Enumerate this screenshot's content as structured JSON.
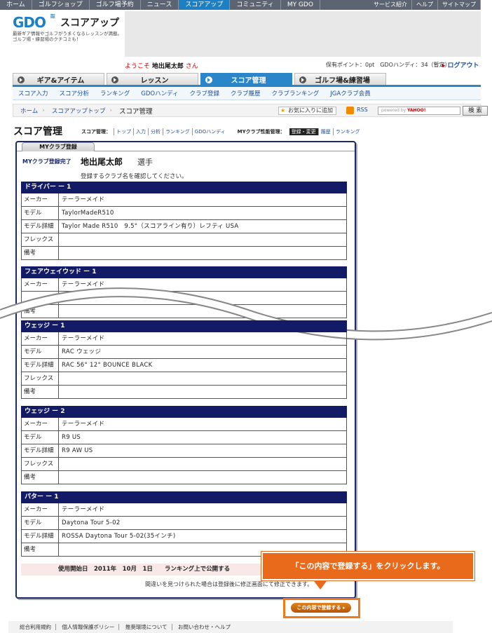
{
  "topnav": {
    "items": [
      "ホーム",
      "ゴルフショップ",
      "ゴルフ場予約",
      "ニュース",
      "スコアアップ",
      "コミュニティ",
      "MY GDO"
    ],
    "right": [
      "サービス紹介",
      "ヘルプ",
      "サイトマップ"
    ]
  },
  "header": {
    "logo": "GDO",
    "site_title": "スコアアップ",
    "tagline": "最新ギア情報やゴルフがうまくなるレッスンが満載。ゴルフ場・練習場のクチコミも！",
    "welcome_prefix": "ようこそ",
    "user_name": "地出尾太郎",
    "welcome_suffix": "さん",
    "points": "保有ポイント：0pt　GDOハンディ：34（暫定）",
    "logout": "ログアウト"
  },
  "bigtabs": [
    "ギア&アイテム",
    "レッスン",
    "スコア管理",
    "ゴルフ場&練習場"
  ],
  "subnav": [
    "スコア入力",
    "スコア分析",
    "ランキング",
    "GDOハンディ",
    "クラブ登録",
    "クラブ履歴",
    "クラブランキング",
    "JGAクラブ会員"
  ],
  "breadcrumb": [
    "ホーム",
    "スコアアップトップ",
    "スコア管理"
  ],
  "toolbar": {
    "favorite": "お気に入りに追加",
    "rss": "RSS",
    "search_placeholder": "powered by",
    "search_brand": "YAHOO!",
    "search_button": "検 索"
  },
  "page": {
    "title": "スコア管理",
    "menu1_label": "スコア管理：",
    "menu1": [
      "トップ",
      "入力",
      "分析",
      "ランキング",
      "GDOハンディ"
    ],
    "menu2_label": "MYクラブ性能管理：",
    "menu2": [
      "登録・変更",
      "履歴",
      "ランキング"
    ]
  },
  "card": {
    "tab": "MYクラブ登録",
    "done_label": "MYクラブ登録完了",
    "player_name": "地出尾太郎",
    "player_suffix": "選手",
    "confirm": "登録するクラブ名を確認してください。",
    "sections": [
      {
        "head": "ドライバー ー 1",
        "rows": [
          {
            "k": "メーカー",
            "v": "テーラーメイド"
          },
          {
            "k": "モデル",
            "v": "TaylorMadeR510"
          },
          {
            "k": "モデル詳細",
            "v": "Taylor Made R510　9.5°（スコアライン有り）レフティ USA"
          },
          {
            "k": "フレックス",
            "v": ""
          },
          {
            "k": "備考",
            "v": ""
          }
        ]
      },
      {
        "head": "フェアウェイウッド ー 1",
        "rows": [
          {
            "k": "メーカー",
            "v": "テーラーメイド"
          },
          {
            "k": "",
            "v": ""
          },
          {
            "k": "備考",
            "v": ""
          }
        ]
      },
      {
        "head": "ウェッジ ー 1",
        "rows": [
          {
            "k": "メーカー",
            "v": "テーラーメイド"
          },
          {
            "k": "モデル",
            "v": "RAC ウェッジ"
          },
          {
            "k": "モデル詳細",
            "v": "RAC 56° 12° BOUNCE BLACK"
          },
          {
            "k": "フレックス",
            "v": ""
          },
          {
            "k": "備考",
            "v": ""
          }
        ]
      },
      {
        "head": "ウェッジ ー 2",
        "rows": [
          {
            "k": "メーカー",
            "v": "テーラーメイド"
          },
          {
            "k": "モデル",
            "v": "R9 US"
          },
          {
            "k": "モデル詳細",
            "v": "R9 AW US"
          },
          {
            "k": "フレックス",
            "v": ""
          },
          {
            "k": "備考",
            "v": ""
          }
        ]
      },
      {
        "head": "パター ー 1",
        "rows": [
          {
            "k": "メーカー",
            "v": "テーラーメイド"
          },
          {
            "k": "モデル",
            "v": "Daytona Tour 5-02"
          },
          {
            "k": "モデル詳細",
            "v": "ROSSA Daytona Tour 5-02(35インチ)"
          },
          {
            "k": "備考",
            "v": ""
          }
        ]
      }
    ],
    "start": "使用開始日　2011年　10月　1日　　ランキング上で公開する",
    "note": "間違いを見つけられた場合は登録後に修正画面にて修正できます。",
    "submit": "この内容で登録する ▸"
  },
  "callout": "「この内容で登録する」をクリックします。",
  "footer": [
    "総合利用規約",
    "個人情報保護ポリシー",
    "推奨環境について",
    "お問い合わせ・ヘルプ"
  ],
  "colors": {
    "accent": "#1d7fc4",
    "navy": "#131a66",
    "callout": "#e96a1b"
  }
}
